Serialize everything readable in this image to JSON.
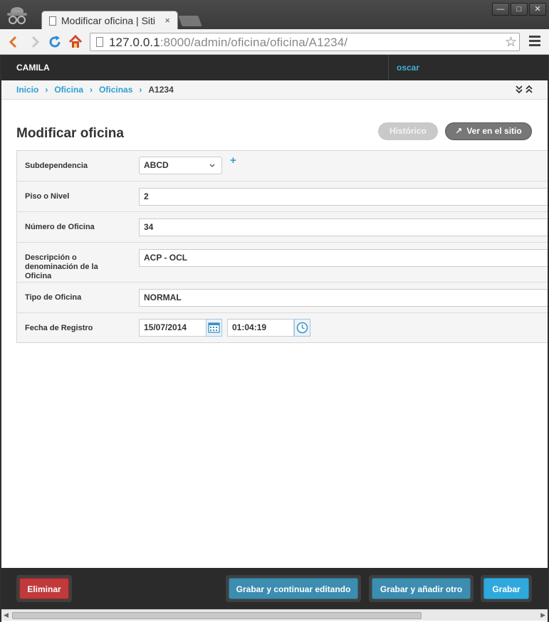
{
  "browser": {
    "tab_title": "Modificar oficina | Siti",
    "tab_close": "×",
    "url_host": "127.0.0.1",
    "url_rest": ":8000/admin/oficina/oficina/A1234/",
    "window_buttons": [
      "—",
      "□",
      "✕"
    ]
  },
  "header": {
    "brand": "CAMILA",
    "username": "oscar"
  },
  "breadcrumbs": {
    "items": [
      "Inicio",
      "Oficina",
      "Oficinas"
    ],
    "current": "A1234",
    "separator": "›",
    "collapse": "⌄⌃"
  },
  "page": {
    "title": "Modificar oficina",
    "history_button": "Histórico",
    "view_site_button": "Ver en el sitio",
    "view_site_icon": "↗"
  },
  "form": {
    "subdependencia": {
      "label": "Subdependencia",
      "value": "ABCD",
      "add": "+"
    },
    "piso": {
      "label": "Piso o Nivel",
      "value": "2"
    },
    "numero": {
      "label": "Número de Oficina",
      "value": "34"
    },
    "descripcion": {
      "label": "Descripción o denominación de la Oficina",
      "value": "ACP - OCL"
    },
    "tipo": {
      "label": "Tipo de Oficina",
      "value": "NORMAL"
    },
    "fecha": {
      "label": "Fecha de Registro",
      "date": "15/07/2014",
      "time": "01:04:19"
    }
  },
  "footer": {
    "delete": "Eliminar",
    "save_continue": "Grabar y continuar editando",
    "save_add": "Grabar y añadir otro",
    "save": "Grabar"
  },
  "colors": {
    "accent": "#2e9fd1",
    "danger": "#c0393b",
    "header_bg": "#2b2b2b"
  }
}
